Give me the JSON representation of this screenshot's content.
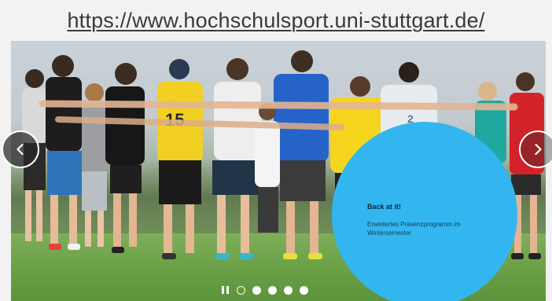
{
  "header": {
    "url_text": "https://www.hochschulsport.uni-stuttgart.de/"
  },
  "slider": {
    "prev_icon": "chevron-left-icon",
    "next_icon": "chevron-right-icon",
    "promo": {
      "title": "Back at it!",
      "text": "Erweitertes Präsenzprogramm im Wintersemester"
    },
    "pagination": {
      "pause_icon": "pause-icon",
      "dot_count": 5,
      "active_index": 0
    },
    "colors": {
      "promo_circle": "#33b6f0",
      "nav_button": "#282828"
    }
  }
}
